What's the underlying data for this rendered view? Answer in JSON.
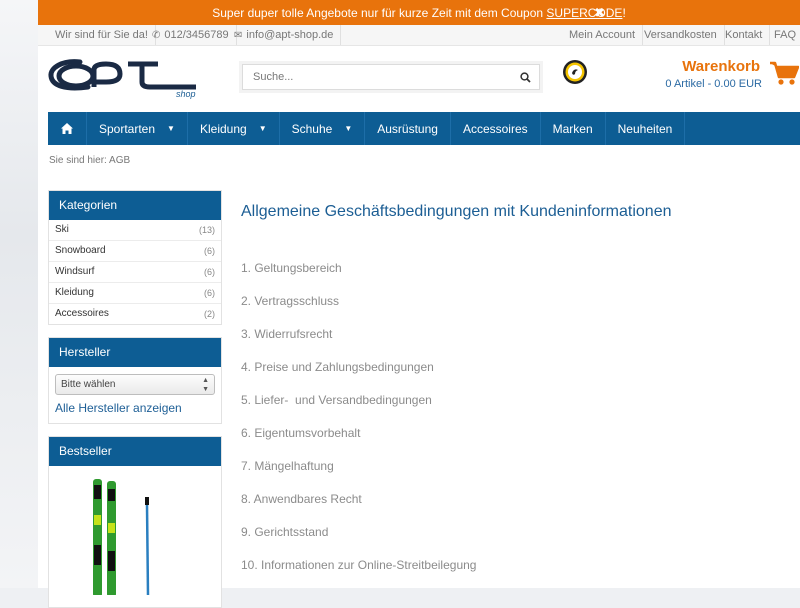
{
  "promo": {
    "text": "Super duper tolle Angebote nur für kurze Zeit mit dem Coupon ",
    "code": "SUPERCODE",
    "suffix": "!",
    "close": "✖"
  },
  "util": {
    "support": "Wir sind für Sie da!",
    "phone": "012/3456789",
    "email": "info@apt-shop.de",
    "account": "Mein Account",
    "shipping": "Versandkosten",
    "contact": "Kontakt",
    "faq": "FAQ"
  },
  "logo": {
    "brand": "apt",
    "sub": "shop"
  },
  "search": {
    "placeholder": "Suche..."
  },
  "cart": {
    "title": "Warenkorb",
    "summary": "0 Artikel - 0.00 EUR"
  },
  "nav": [
    {
      "label": "Sportarten",
      "dropdown": true
    },
    {
      "label": "Kleidung",
      "dropdown": true
    },
    {
      "label": "Schuhe",
      "dropdown": true
    },
    {
      "label": "Ausrüstung",
      "dropdown": false
    },
    {
      "label": "Accessoires",
      "dropdown": false
    },
    {
      "label": "Marken",
      "dropdown": false
    },
    {
      "label": "Neuheiten",
      "dropdown": false
    }
  ],
  "breadcrumb": "Sie sind hier: AGB",
  "categories": {
    "title": "Kategorien",
    "items": [
      {
        "label": "Ski",
        "count": "(13)"
      },
      {
        "label": "Snowboard",
        "count": "(6)"
      },
      {
        "label": "Windsurf",
        "count": "(6)"
      },
      {
        "label": "Kleidung",
        "count": "(6)"
      },
      {
        "label": "Accessoires",
        "count": "(2)"
      }
    ]
  },
  "manufacturers": {
    "title": "Hersteller",
    "select_value": "Bitte wählen",
    "all_link": "Alle Hersteller anzeigen"
  },
  "bestseller": {
    "title": "Bestseller"
  },
  "content": {
    "title": "Allgemeine Geschäftsbedingungen mit Kundeninformationen",
    "sections": [
      "1. Geltungsbereich",
      "2. Vertragsschluss",
      "3. Widerrufsrecht",
      "4. Preise und Zahlungsbedingungen",
      "5. Liefer-  und Versandbedingungen",
      "6. Eigentumsvorbehalt",
      "7. Mängelhaftung",
      "8. Anwendbares Recht",
      "9. Gerichtsstand",
      "10. Informationen zur Online-Streitbeilegung"
    ]
  },
  "colors": {
    "accent": "#e8730c",
    "primary": "#0d5d94",
    "link": "#1e5f96"
  }
}
